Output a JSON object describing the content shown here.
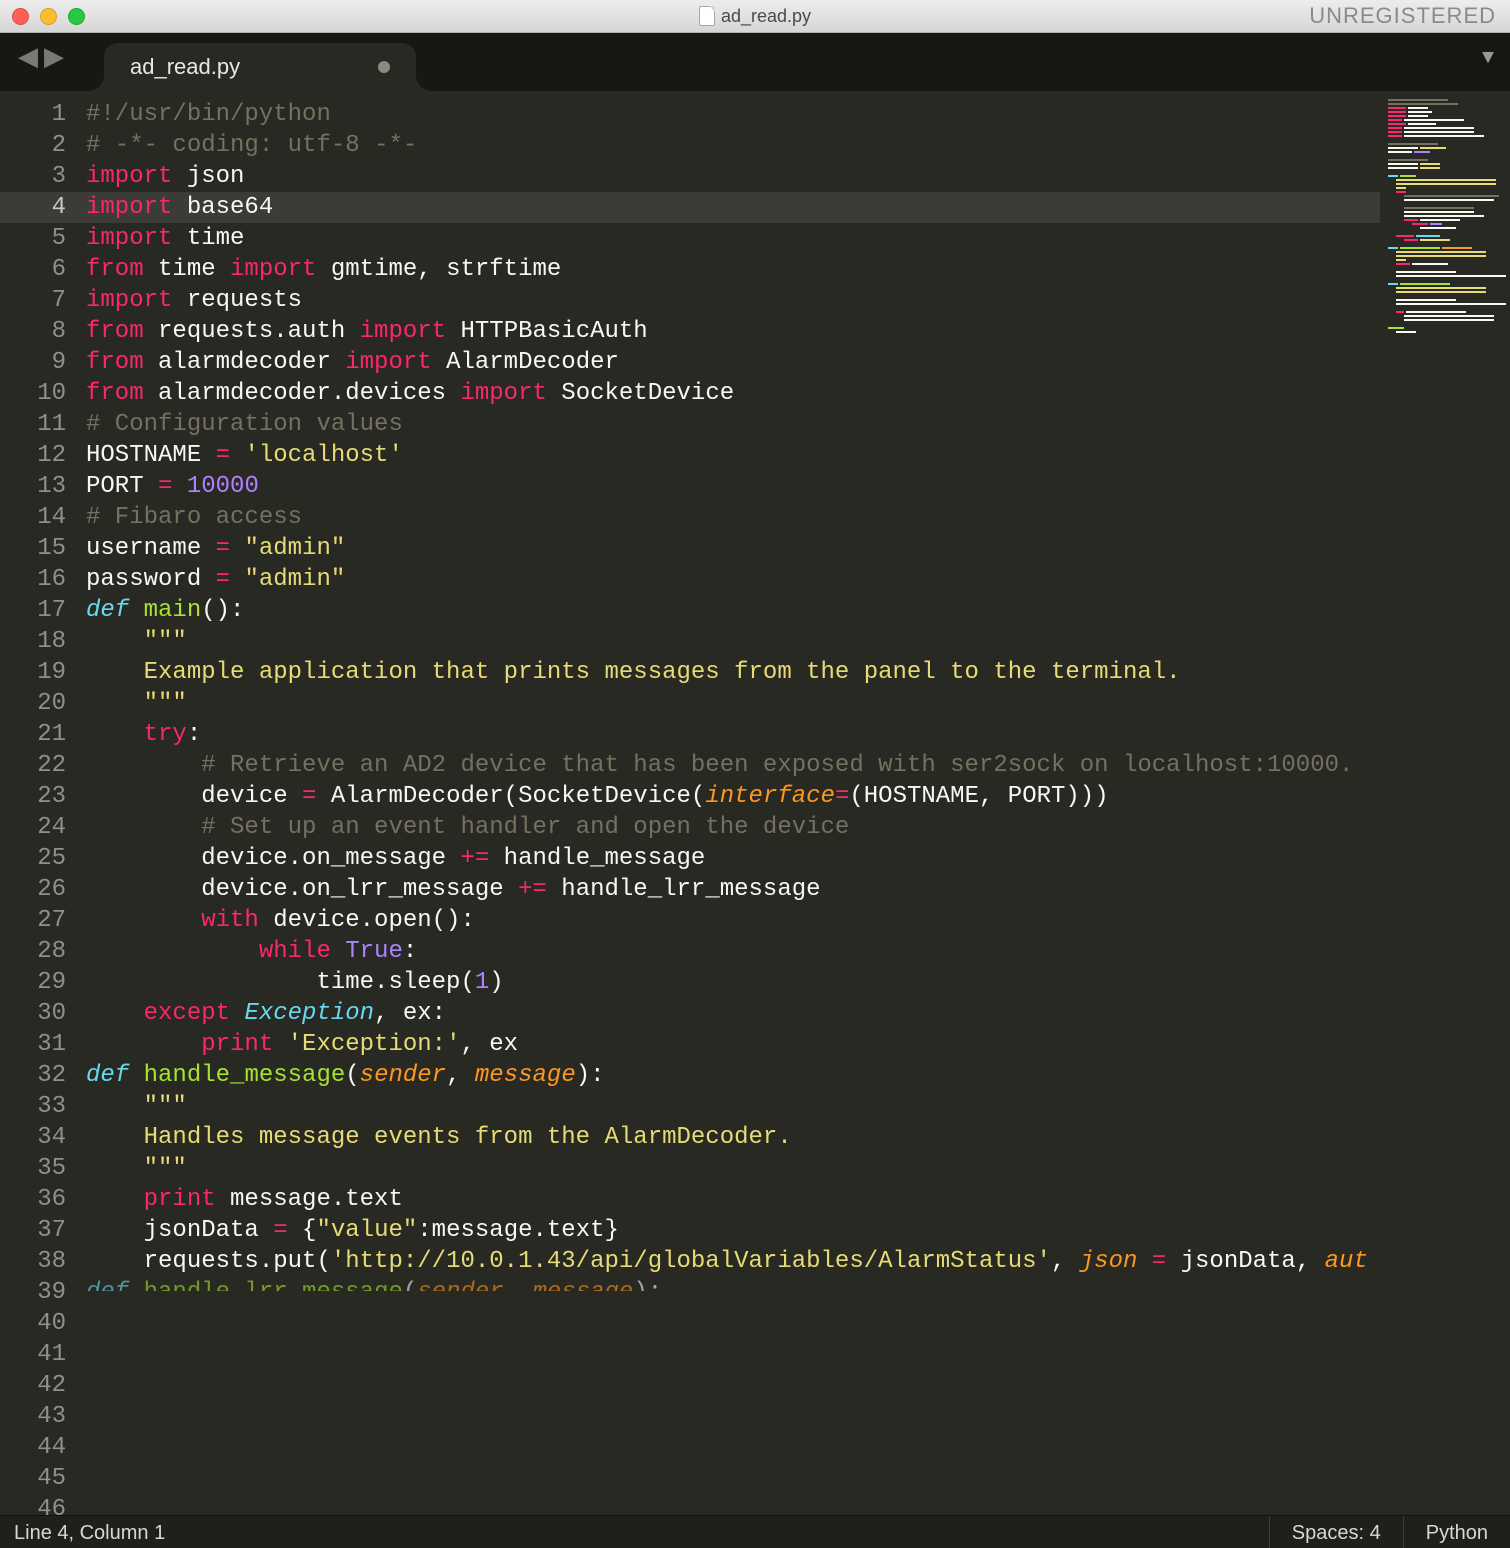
{
  "window": {
    "title": "ad_read.py",
    "unregistered_label": "UNREGISTERED"
  },
  "tab": {
    "title": "ad_read.py"
  },
  "status": {
    "position": "Line 4, Column 1",
    "indent": "Spaces: 4",
    "syntax": "Python"
  },
  "active_line": 4,
  "code_lines": [
    {
      "n": 1,
      "tokens": [
        [
          "c-comment",
          "#!/usr/bin/python"
        ]
      ]
    },
    {
      "n": 2,
      "tokens": [
        [
          "c-comment",
          "# -*- coding: utf-8 -*-"
        ]
      ]
    },
    {
      "n": 3,
      "tokens": [
        [
          "c-keyword",
          "import"
        ],
        [
          "c-plain",
          " json"
        ]
      ]
    },
    {
      "n": 4,
      "tokens": [
        [
          "c-keyword",
          "import"
        ],
        [
          "c-plain",
          " base64"
        ]
      ]
    },
    {
      "n": 5,
      "tokens": [
        [
          "c-keyword",
          "import"
        ],
        [
          "c-plain",
          " time"
        ]
      ]
    },
    {
      "n": 6,
      "tokens": [
        [
          "c-keyword",
          "from"
        ],
        [
          "c-plain",
          " time "
        ],
        [
          "c-keyword",
          "import"
        ],
        [
          "c-plain",
          " gmtime, strftime"
        ]
      ]
    },
    {
      "n": 7,
      "tokens": [
        [
          "c-keyword",
          "import"
        ],
        [
          "c-plain",
          " requests"
        ]
      ]
    },
    {
      "n": 8,
      "tokens": [
        [
          "c-keyword",
          "from"
        ],
        [
          "c-plain",
          " requests.auth "
        ],
        [
          "c-keyword",
          "import"
        ],
        [
          "c-plain",
          " HTTPBasicAuth"
        ]
      ]
    },
    {
      "n": 9,
      "tokens": [
        [
          "c-keyword",
          "from"
        ],
        [
          "c-plain",
          " alarmdecoder "
        ],
        [
          "c-keyword",
          "import"
        ],
        [
          "c-plain",
          " AlarmDecoder"
        ]
      ]
    },
    {
      "n": 10,
      "tokens": [
        [
          "c-keyword",
          "from"
        ],
        [
          "c-plain",
          " alarmdecoder.devices "
        ],
        [
          "c-keyword",
          "import"
        ],
        [
          "c-plain",
          " SocketDevice"
        ]
      ]
    },
    {
      "n": 11,
      "tokens": [
        [
          "c-plain",
          ""
        ]
      ]
    },
    {
      "n": 12,
      "tokens": [
        [
          "c-comment",
          "# Configuration values"
        ]
      ]
    },
    {
      "n": 13,
      "tokens": [
        [
          "c-plain",
          "HOSTNAME "
        ],
        [
          "c-op",
          "="
        ],
        [
          "c-plain",
          " "
        ],
        [
          "c-string",
          "'localhost'"
        ]
      ]
    },
    {
      "n": 14,
      "tokens": [
        [
          "c-plain",
          "PORT "
        ],
        [
          "c-op",
          "="
        ],
        [
          "c-plain",
          " "
        ],
        [
          "c-number",
          "10000"
        ]
      ]
    },
    {
      "n": 15,
      "tokens": [
        [
          "c-plain",
          ""
        ]
      ]
    },
    {
      "n": 16,
      "tokens": [
        [
          "c-comment",
          "# Fibaro access"
        ]
      ]
    },
    {
      "n": 17,
      "tokens": [
        [
          "c-plain",
          "username "
        ],
        [
          "c-op",
          "="
        ],
        [
          "c-plain",
          " "
        ],
        [
          "c-string",
          "\"admin\""
        ]
      ]
    },
    {
      "n": 18,
      "tokens": [
        [
          "c-plain",
          "password "
        ],
        [
          "c-op",
          "="
        ],
        [
          "c-plain",
          " "
        ],
        [
          "c-string",
          "\"admin\""
        ]
      ]
    },
    {
      "n": 19,
      "tokens": [
        [
          "c-plain",
          ""
        ]
      ]
    },
    {
      "n": 20,
      "tokens": [
        [
          "c-def",
          "def"
        ],
        [
          "c-plain",
          " "
        ],
        [
          "c-func",
          "main"
        ],
        [
          "c-plain",
          "():"
        ]
      ]
    },
    {
      "n": 21,
      "tokens": [
        [
          "c-plain",
          "    "
        ],
        [
          "c-string",
          "\"\"\""
        ]
      ]
    },
    {
      "n": 22,
      "tokens": [
        [
          "c-plain",
          "    "
        ],
        [
          "c-string",
          "Example application that prints messages from the panel to the terminal."
        ]
      ]
    },
    {
      "n": 23,
      "tokens": [
        [
          "c-plain",
          "    "
        ],
        [
          "c-string",
          "\"\"\""
        ]
      ]
    },
    {
      "n": 24,
      "tokens": [
        [
          "c-plain",
          "    "
        ],
        [
          "c-keyword",
          "try"
        ],
        [
          "c-plain",
          ":"
        ]
      ]
    },
    {
      "n": 25,
      "tokens": [
        [
          "c-plain",
          "        "
        ],
        [
          "c-comment",
          "# Retrieve an AD2 device that has been exposed with ser2sock on localhost:10000."
        ]
      ]
    },
    {
      "n": 26,
      "tokens": [
        [
          "c-plain",
          "        device "
        ],
        [
          "c-op",
          "="
        ],
        [
          "c-plain",
          " AlarmDecoder(SocketDevice("
        ],
        [
          "c-param",
          "interface"
        ],
        [
          "c-op",
          "="
        ],
        [
          "c-plain",
          "(HOSTNAME, PORT)))"
        ]
      ]
    },
    {
      "n": 27,
      "tokens": [
        [
          "c-plain",
          ""
        ]
      ]
    },
    {
      "n": 28,
      "tokens": [
        [
          "c-plain",
          "        "
        ],
        [
          "c-comment",
          "# Set up an event handler and open the device"
        ]
      ]
    },
    {
      "n": 29,
      "tokens": [
        [
          "c-plain",
          "        device.on_message "
        ],
        [
          "c-op",
          "+="
        ],
        [
          "c-plain",
          " handle_message"
        ]
      ]
    },
    {
      "n": 30,
      "tokens": [
        [
          "c-plain",
          "        device.on_lrr_message "
        ],
        [
          "c-op",
          "+="
        ],
        [
          "c-plain",
          " handle_lrr_message"
        ]
      ]
    },
    {
      "n": 31,
      "tokens": [
        [
          "c-plain",
          "        "
        ],
        [
          "c-keyword",
          "with"
        ],
        [
          "c-plain",
          " device.open():"
        ]
      ]
    },
    {
      "n": 32,
      "tokens": [
        [
          "c-plain",
          "            "
        ],
        [
          "c-keyword",
          "while"
        ],
        [
          "c-plain",
          " "
        ],
        [
          "c-const",
          "True"
        ],
        [
          "c-plain",
          ":"
        ]
      ]
    },
    {
      "n": 33,
      "tokens": [
        [
          "c-plain",
          "                time.sleep("
        ],
        [
          "c-number",
          "1"
        ],
        [
          "c-plain",
          ")"
        ]
      ]
    },
    {
      "n": 34,
      "tokens": [
        [
          "c-plain",
          ""
        ]
      ]
    },
    {
      "n": 35,
      "tokens": [
        [
          "c-plain",
          "    "
        ],
        [
          "c-keyword",
          "except"
        ],
        [
          "c-plain",
          " "
        ],
        [
          "c-class",
          "Exception"
        ],
        [
          "c-plain",
          ", ex:"
        ]
      ]
    },
    {
      "n": 36,
      "tokens": [
        [
          "c-plain",
          "        "
        ],
        [
          "c-keyword",
          "print"
        ],
        [
          "c-plain",
          " "
        ],
        [
          "c-string",
          "'Exception:'"
        ],
        [
          "c-plain",
          ", ex"
        ]
      ]
    },
    {
      "n": 37,
      "tokens": [
        [
          "c-plain",
          ""
        ]
      ]
    },
    {
      "n": 38,
      "tokens": [
        [
          "c-def",
          "def"
        ],
        [
          "c-plain",
          " "
        ],
        [
          "c-func",
          "handle_message"
        ],
        [
          "c-plain",
          "("
        ],
        [
          "c-param",
          "sender"
        ],
        [
          "c-plain",
          ", "
        ],
        [
          "c-param",
          "message"
        ],
        [
          "c-plain",
          "):"
        ]
      ]
    },
    {
      "n": 39,
      "tokens": [
        [
          "c-plain",
          "    "
        ],
        [
          "c-string",
          "\"\"\""
        ]
      ]
    },
    {
      "n": 40,
      "tokens": [
        [
          "c-plain",
          "    "
        ],
        [
          "c-string",
          "Handles message events from the AlarmDecoder."
        ]
      ]
    },
    {
      "n": 41,
      "tokens": [
        [
          "c-plain",
          "    "
        ],
        [
          "c-string",
          "\"\"\""
        ]
      ]
    },
    {
      "n": 42,
      "tokens": [
        [
          "c-plain",
          "    "
        ],
        [
          "c-keyword",
          "print"
        ],
        [
          "c-plain",
          " message.text"
        ]
      ]
    },
    {
      "n": 43,
      "tokens": [
        [
          "c-plain",
          ""
        ]
      ]
    },
    {
      "n": 44,
      "tokens": [
        [
          "c-plain",
          "    jsonData "
        ],
        [
          "c-op",
          "="
        ],
        [
          "c-plain",
          " {"
        ],
        [
          "c-string",
          "\"value\""
        ],
        [
          "c-plain",
          ":message.text}"
        ]
      ]
    },
    {
      "n": 45,
      "tokens": [
        [
          "c-plain",
          "    requests.put("
        ],
        [
          "c-string",
          "'http://10.0.1.43/api/globalVariables/AlarmStatus'"
        ],
        [
          "c-plain",
          ", "
        ],
        [
          "c-param",
          "json"
        ],
        [
          "c-plain",
          " "
        ],
        [
          "c-op",
          "="
        ],
        [
          "c-plain",
          " jsonData, "
        ],
        [
          "c-param",
          "aut"
        ]
      ]
    },
    {
      "n": 46,
      "tokens": [
        [
          "c-plain",
          ""
        ]
      ]
    }
  ]
}
